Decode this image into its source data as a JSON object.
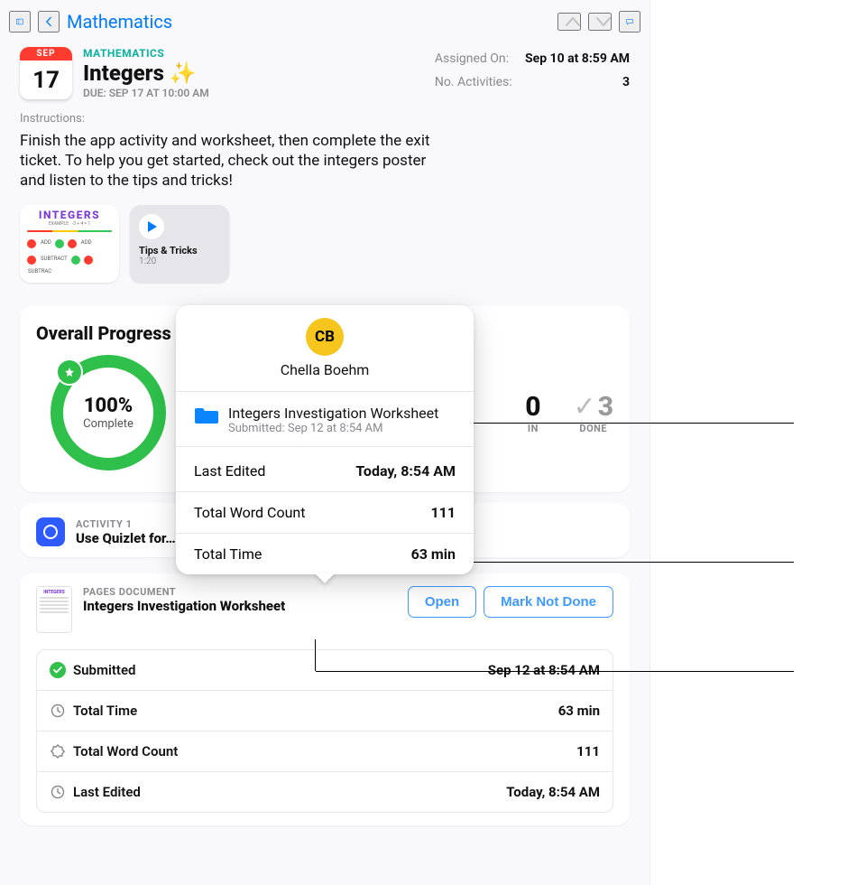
{
  "nav": {
    "back_label": "Mathematics"
  },
  "header": {
    "category": "MATHEMATICS",
    "title": "Integers",
    "sparkle": "✨",
    "due": "DUE: SEP 17 AT 10:00 AM",
    "cal_month": "SEP",
    "cal_day": "17",
    "assigned_label": "Assigned On:",
    "assigned_value": "Sep 10 at 8:59 AM",
    "activities_label": "No. Activities:",
    "activities_value": "3"
  },
  "instructions": {
    "label": "Instructions:",
    "body": "Finish the app activity and worksheet, then complete the exit ticket. To help you get started, check out the integers poster and listen to the tips and tricks!"
  },
  "attachments": {
    "poster_title": "INTEGERS",
    "tips_title": "Tips & Tricks",
    "tips_duration": "1:20"
  },
  "progress": {
    "title": "Overall Progress",
    "percent": "100%",
    "percent_sub": "Complete",
    "kpi_partial_label": "IN",
    "kpi_partial_value": "0",
    "kpi_done_label": "DONE",
    "kpi_done_value": "3"
  },
  "activity1": {
    "label": "ACTIVITY 1",
    "name": "Use Quizlet for…"
  },
  "document": {
    "label": "PAGES DOCUMENT",
    "name": "Integers Investigation Worksheet",
    "open_btn": "Open",
    "mark_btn": "Mark Not Done",
    "rows": {
      "submitted_label": "Submitted",
      "submitted_value": "Sep 12 at 8:54 AM",
      "time_label": "Total Time",
      "time_value": "63 min",
      "words_label": "Total Word Count",
      "words_value": "111",
      "edited_label": "Last Edited",
      "edited_value": "Today, 8:54 AM"
    }
  },
  "popover": {
    "initials": "CB",
    "name": "Chella Boehm",
    "file": "Integers Investigation Worksheet",
    "file_sub": "Submitted: Sep 12 at 8:54 AM",
    "last_edited_label": "Last Edited",
    "last_edited_value": "Today, 8:54 AM",
    "words_label": "Total Word Count",
    "words_value": "111",
    "time_label": "Total Time",
    "time_value": "63 min"
  }
}
